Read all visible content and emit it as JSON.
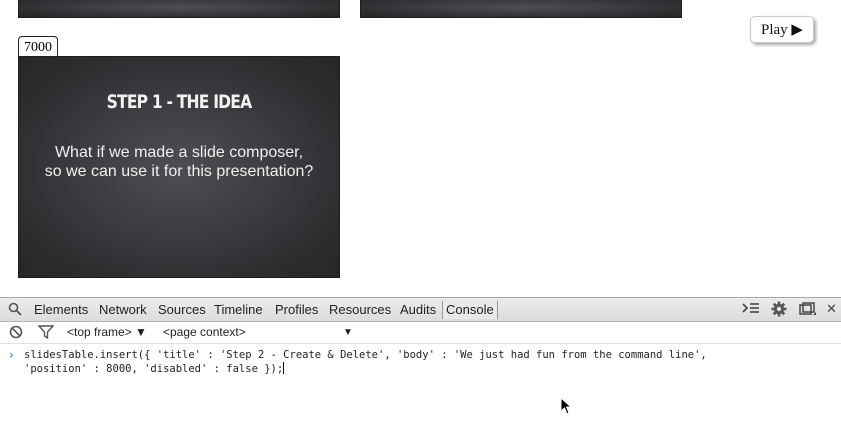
{
  "slides": {
    "main": {
      "position": "7000",
      "title": "STEP 1 - THE IDEA",
      "body": "What if we made a slide composer,\nso we can use it for this presentation?"
    }
  },
  "play_button": {
    "label": "Play ▶"
  },
  "devtools": {
    "tabs": [
      "Elements",
      "Network",
      "Sources",
      "Timeline",
      "Profiles",
      "Resources",
      "Audits",
      "Console"
    ],
    "active_tab": "Console",
    "frame_selector": "<top frame> ▼",
    "context_selector": "<page context>",
    "context_arrow": "▼",
    "console_input": "slidesTable.insert({ 'title' : 'Step 2 - Create & Delete', 'body' : 'We just had fun from the command line',\n'position' : 8000, 'disabled' : false });"
  },
  "icons": {
    "search": "search-icon",
    "console_drawer": "console-drawer-icon",
    "settings": "gear-icon",
    "dock": "dock-icon",
    "close": "close-icon",
    "clear": "clear-console-icon",
    "filter": "filter-icon"
  }
}
